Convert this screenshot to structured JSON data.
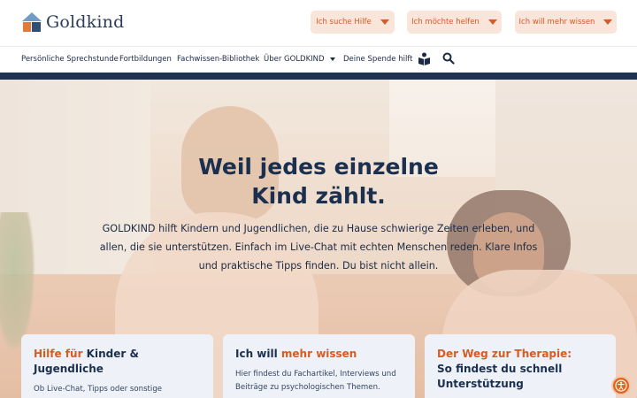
{
  "brand": {
    "name": "Goldkind"
  },
  "top_buttons": [
    {
      "label": "Ich suche Hilfe"
    },
    {
      "label": "Ich möchte helfen"
    },
    {
      "label": "Ich will mehr wissen"
    }
  ],
  "nav": {
    "items": [
      {
        "label": "Persönliche Sprechstunde"
      },
      {
        "label": "Fortbildungen"
      },
      {
        "label": "Fachwissen-Bibliothek"
      },
      {
        "label": "Über GOLDKIND"
      },
      {
        "label": "Deine Spende hilft"
      }
    ]
  },
  "hero": {
    "title_line1": "Weil jedes einzelne",
    "title_line2": "Kind zählt.",
    "text": "GOLDKIND hilft Kindern und Jugendlichen, die zu Hause schwierige Zeiten erleben, und allen, die sie unterstützen. Einfach im Live-Chat mit echten Menschen reden. Klare Infos und praktische Tipps finden. Du bist nicht allein."
  },
  "cards": [
    {
      "title_hl": "Hilfe für",
      "title_rest": " Kinder & Jugendliche",
      "text": "Ob Live-Chat, Tipps oder sonstige Informationen. Hier findest du die Hilfe, die"
    },
    {
      "title_pre": "Ich will ",
      "title_hl": "mehr wissen",
      "text": "Hier findest du Fachartikel, Interviews und Beiträge zu psychologischen Themen."
    },
    {
      "title_hl": "Der Weg zur Therapie:",
      "title_rest": "So findest du schnell Unterstützung"
    }
  ],
  "colors": {
    "accent": "#d65b24",
    "navy": "#1b2f4e",
    "pill_bg": "#f9e5da",
    "card_bg": "#eef2f8"
  }
}
